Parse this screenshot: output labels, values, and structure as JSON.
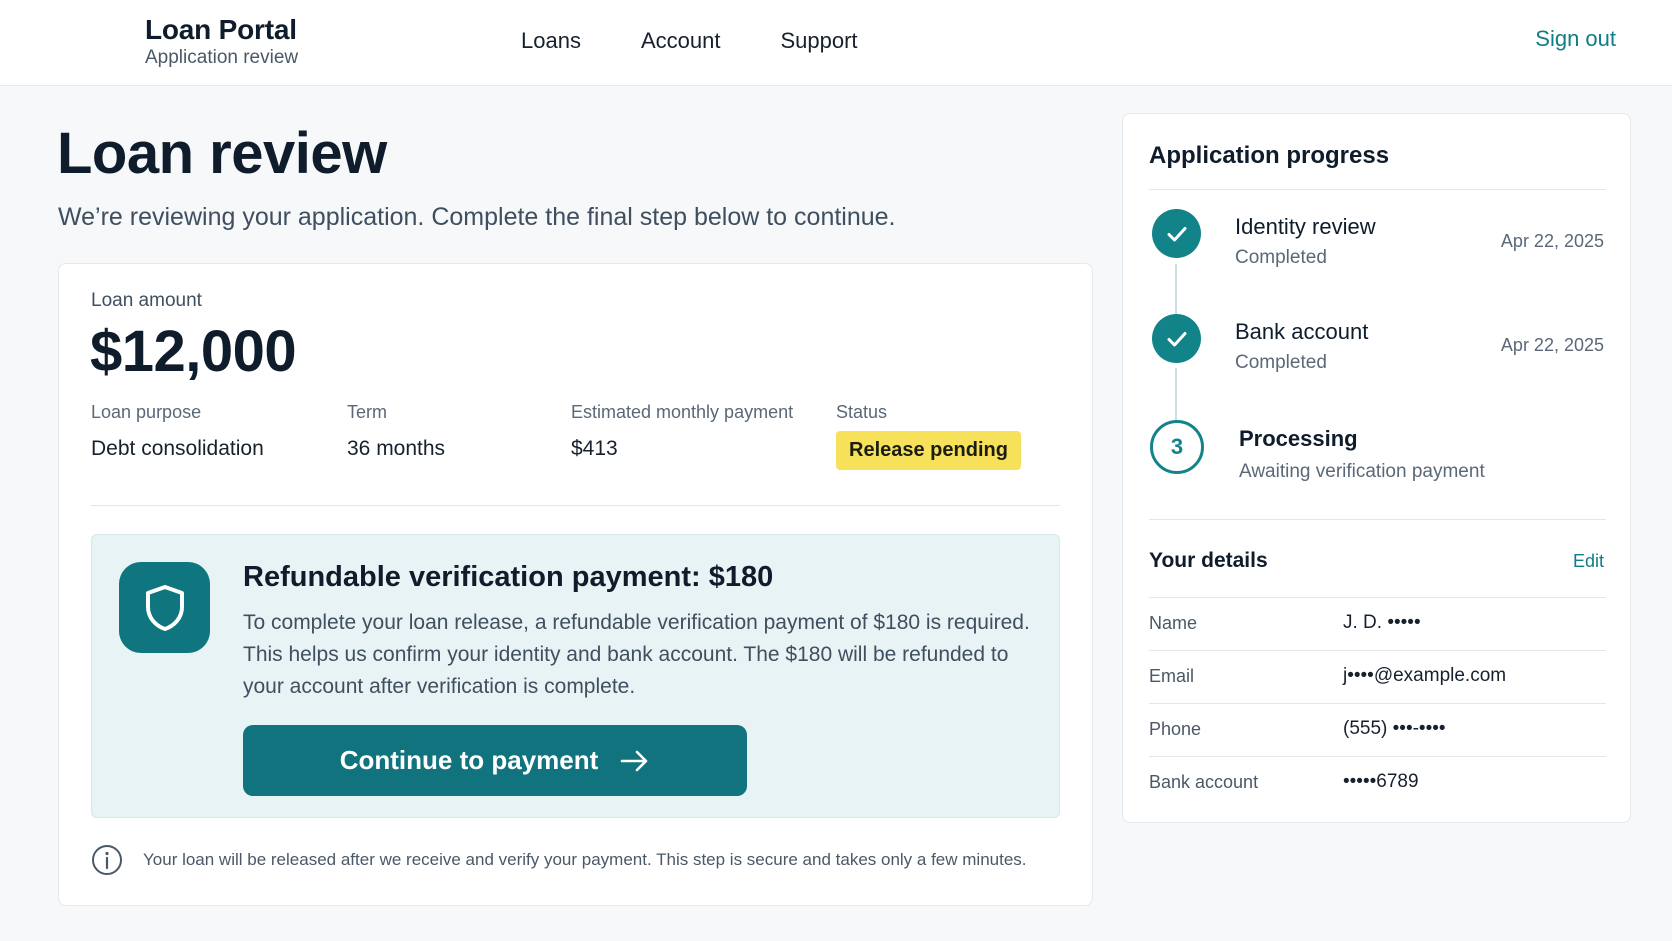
{
  "header": {
    "brand_title": "Loan Portal",
    "brand_subtitle": "Application review",
    "nav": [
      "Loans",
      "Account",
      "Support"
    ],
    "sign_out": "Sign out"
  },
  "page": {
    "title": "Loan review",
    "subtitle": "We’re reviewing your application. Complete the final step below to continue."
  },
  "loan": {
    "amount_label": "Loan amount",
    "amount": "$12,000",
    "purpose_label": "Loan purpose",
    "purpose": "Debt consolidation",
    "term_label": "Term",
    "term": "36 months",
    "payment_label": "Estimated monthly payment",
    "payment": "$413",
    "status_label": "Status",
    "status": "Release pending",
    "status_color": "#f8e15a"
  },
  "verification": {
    "icon": "shield-icon",
    "title": "Refundable verification payment: $180",
    "body": "To complete your loan release, a refundable verification payment of $180 is required. This helps us confirm your identity and bank account. The $180 will be refunded to your account after verification is complete.",
    "button_label": "Continue to payment",
    "button_color": "#10737d"
  },
  "info_note": "Your loan will be released after we receive and verify your payment. This step is secure and takes only a few minutes.",
  "progress": {
    "title": "Application progress",
    "steps": [
      {
        "title": "Identity review",
        "status": "Completed",
        "date": "Apr 22, 2025"
      },
      {
        "title": "Bank account",
        "status": "Completed",
        "date": "Apr 22, 2025"
      },
      {
        "number": "3",
        "title": "Processing",
        "status": "Awaiting verification payment"
      }
    ]
  },
  "details": {
    "title": "Your details",
    "edit_label": "Edit",
    "rows": [
      {
        "label": "Name",
        "value": "J. D. •••••"
      },
      {
        "label": "Email",
        "value": "j••••@example.com"
      },
      {
        "label": "Phone",
        "value": "(555) •••-••••"
      },
      {
        "label": "Bank account",
        "value": "•••••6789"
      }
    ]
  },
  "accent_color": "#13838a"
}
